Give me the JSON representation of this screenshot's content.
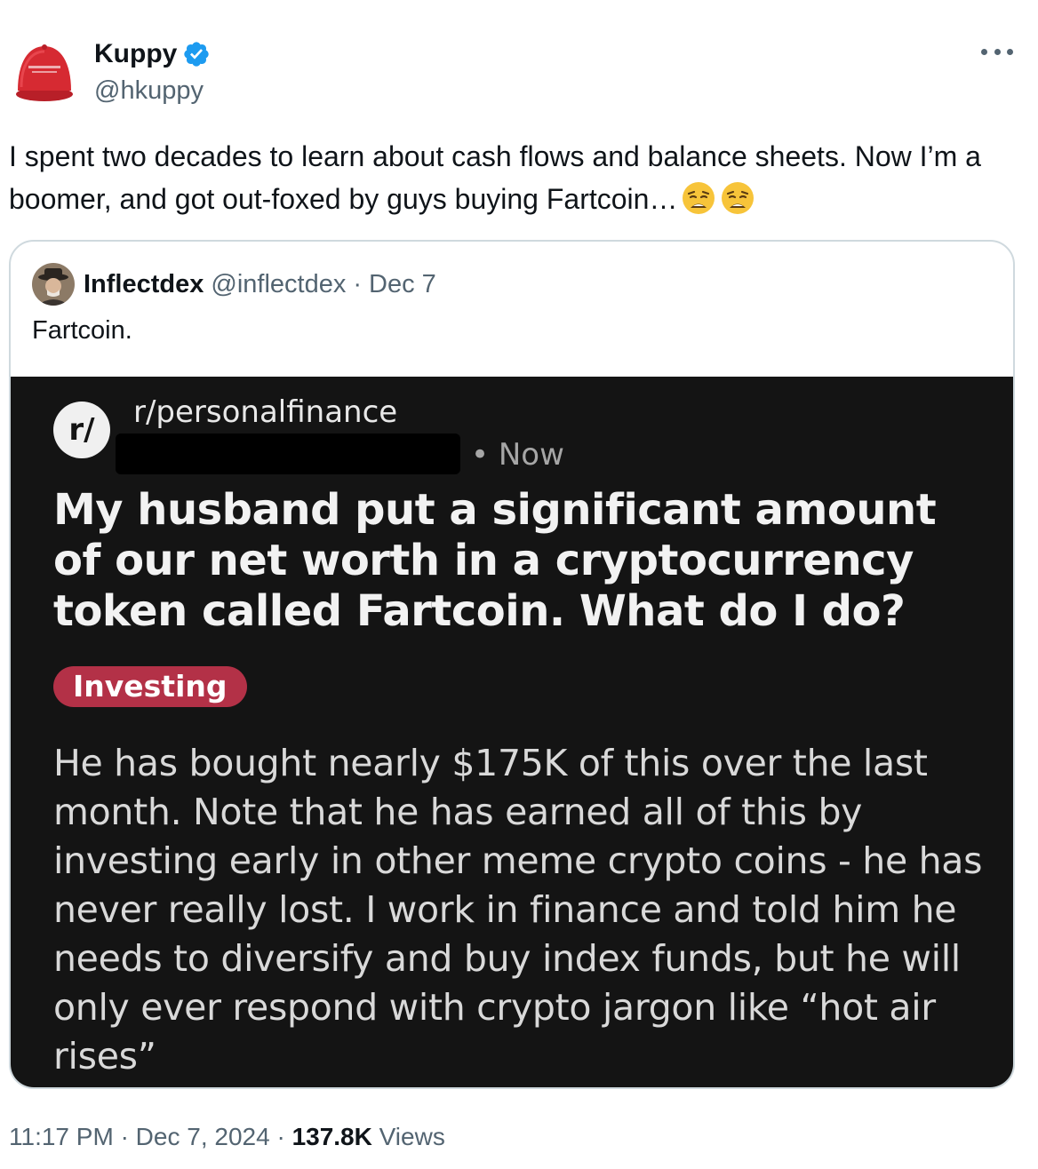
{
  "author": {
    "display_name": "Kuppy",
    "handle": "@hkuppy",
    "verified": true
  },
  "tweet": {
    "text": "I spent two decades to learn about cash flows and balance sheets. Now I’m a boomer, and got out-foxed by guys buying Fartcoin…",
    "emojis": [
      "weary-face-emoji",
      "weary-face-emoji"
    ]
  },
  "quote": {
    "display_name": "Inflectdex",
    "handle": "@inflectdex",
    "separator": "·",
    "date": "Dec 7",
    "text": "Fartcoin.",
    "image": {
      "logo_text": "r/",
      "subreddit": "r/personalfinance",
      "time": "• Now",
      "title": "My husband put a significant amount of our net worth in a cryptocurrency token called Fartcoin. What do I do?",
      "flair": "Investing",
      "body": "He has bought nearly $175K of this over the last month. Note that he has earned all of this by investing early in other meme crypto coins - he has never really lost. I work in finance and told him he needs to diversify and buy index funds, but he will only ever respond with crypto jargon like “hot air rises”"
    }
  },
  "meta": {
    "time": "11:17 PM",
    "separator": "·",
    "date": "Dec 7, 2024",
    "views_count": "137.8K",
    "views_label": "Views"
  },
  "colors": {
    "verified_blue": "#1d9bf0",
    "flair_red": "#b33147",
    "hat_red": "#d62a32",
    "image_bg": "#141414"
  }
}
